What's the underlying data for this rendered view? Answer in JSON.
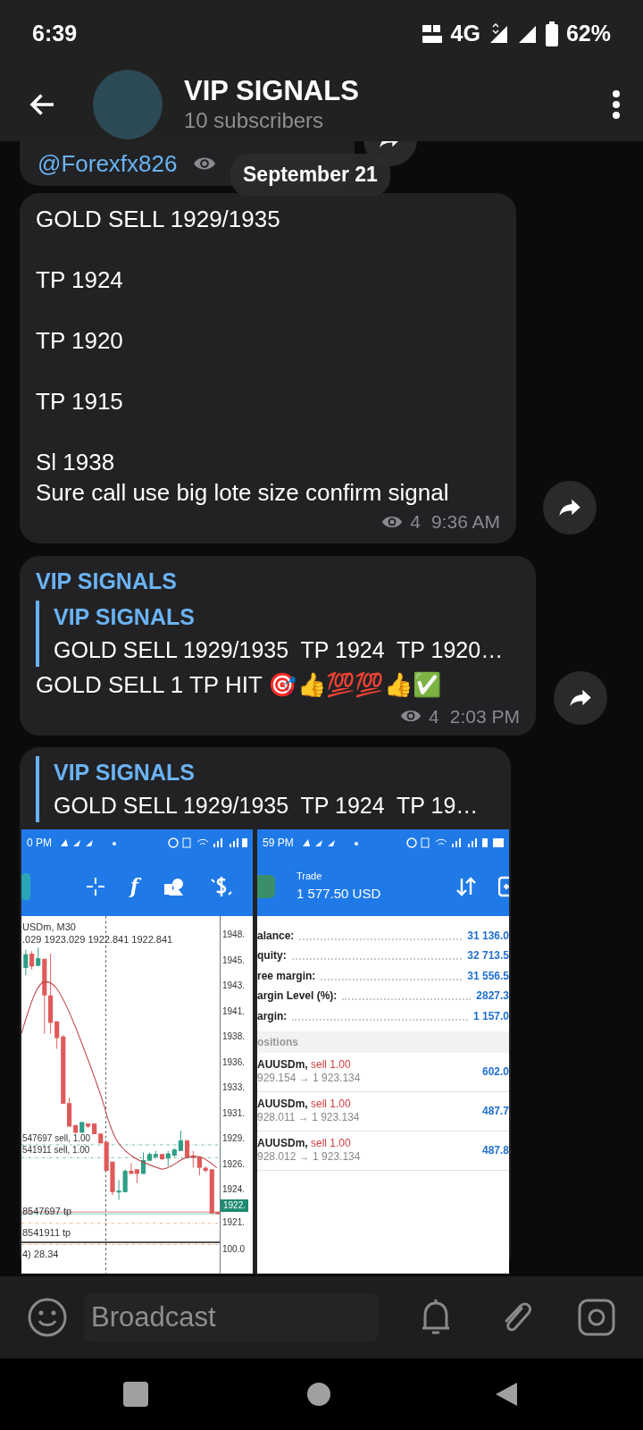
{
  "status_bar": {
    "time": "6:39",
    "network": "4G",
    "battery": "62%"
  },
  "header": {
    "title": "VIP SIGNALS",
    "subtitle": "10 subscribers"
  },
  "date_pill": "September 21",
  "messages": [
    {
      "kind": "partial",
      "link": "@Forexfx826"
    },
    {
      "kind": "text",
      "paragraphs": [
        [
          "GOLD SELL 1929/1935"
        ],
        [
          "TP 1924"
        ],
        [
          "TP 1920"
        ],
        [
          "TP 1915"
        ],
        [
          "Sl 1938",
          "Sure call use big lote size confirm signal"
        ]
      ],
      "views": "4",
      "time": "9:36 AM"
    },
    {
      "kind": "reply",
      "author": "VIP SIGNALS",
      "reply": {
        "author": "VIP SIGNALS",
        "text": "GOLD SELL 1929/1935  TP 1924  TP 1920…"
      },
      "text": "GOLD SELL 1 TP HIT 🎯👍💯💯👍✅",
      "views": "4",
      "time": "2:03 PM"
    },
    {
      "kind": "photo",
      "reply": {
        "author": "VIP SIGNALS",
        "text": "GOLD SELL 1929/1935  TP 1924  TP 19…"
      },
      "screenshots": [
        {
          "kind": "chart",
          "status_time": "0 PM",
          "tool_glyph": "f",
          "symbol": "USDm, M30",
          "ohlc": ".029 1923.029 1922.841 1922.841",
          "price_labels": [
            "1948.",
            "1945.",
            "1943.",
            "1941.",
            "1938.",
            "1936.",
            "1933.",
            "1931.",
            "1929.",
            "1926.",
            "1924."
          ],
          "current_price": "1922.",
          "below_price": "1921.",
          "order_labels": [
            "547697 sell, 1.00",
            "541911 sell, 1.00"
          ],
          "tp_labels": [
            "8547697 tp",
            "8541911 tp"
          ],
          "indicator": "4) 28.34",
          "indicator_level": "100.0"
        },
        {
          "kind": "trade",
          "status_time": "59 PM",
          "title": "Trade",
          "amount": "1 577.50 USD",
          "rows": [
            {
              "label": "alance:",
              "value": "31 136.0"
            },
            {
              "label": "quity:",
              "value": "32 713.5"
            },
            {
              "label": "ree margin:",
              "value": "31 556.5"
            },
            {
              "label": "argin Level (%):",
              "value": "2827.3"
            },
            {
              "label": "argin:",
              "value": "1 157.0"
            }
          ],
          "section": "ositions",
          "positions": [
            {
              "symbol": "AUUSDm,",
              "side": "sell 1.00",
              "prices": "929.154 → 1 923.134",
              "profit": "602.0"
            },
            {
              "symbol": "AUUSDm,",
              "side": "sell 1.00",
              "prices": "928.011 → 1 923.134",
              "profit": "487.7"
            },
            {
              "symbol": "AUUSDm,",
              "side": "sell 1.00",
              "prices": "928.012 → 1 923.134",
              "profit": "487.8"
            }
          ]
        }
      ]
    }
  ],
  "input": {
    "placeholder": "Broadcast"
  }
}
